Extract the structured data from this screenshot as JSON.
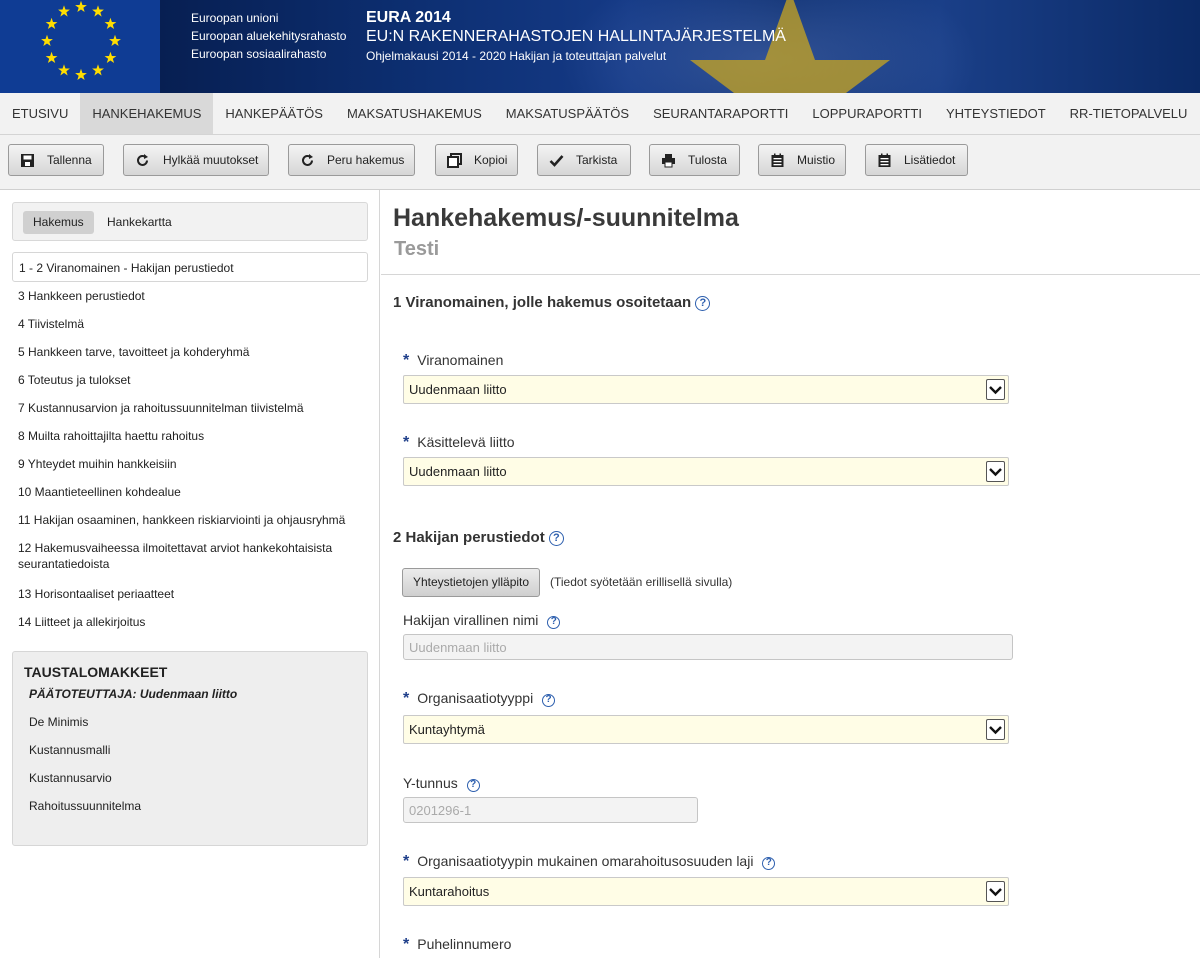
{
  "header": {
    "funds": [
      "Euroopan unioni",
      "Euroopan aluekehitysrahasto",
      "Euroopan sosiaalirahasto"
    ],
    "title": "EURA 2014",
    "subtitle": "EU:N RAKENNERAHASTOJEN HALLINTAJÄRJESTELMÄ",
    "tagline": "Ohjelmakausi 2014 - 2020 Hakijan ja toteuttajan palvelut",
    "flag_color": "#0f3c94",
    "star_color": "#ffdd00"
  },
  "nav": {
    "items": [
      "Etusivu",
      "Hankehakemus",
      "Hankepäätös",
      "Maksatushakemus",
      "Maksatuspäätös",
      "Seurantaraportti",
      "Loppuraportti",
      "Yhteystiedot",
      "RR-tietopalvelu"
    ],
    "active_index": 1
  },
  "toolbar": {
    "save": "Tallenna",
    "reject": "Hylkää muutokset",
    "cancel": "Peru hakemus",
    "copy": "Kopioi",
    "check": "Tarkista",
    "print": "Tulosta",
    "memo": "Muistio",
    "info": "Lisätiedot"
  },
  "sidebar": {
    "tabs": [
      "Hakemus",
      "Hankekartta"
    ],
    "items": [
      "1 - 2 Viranomainen - Hakijan perustiedot",
      "3 Hankkeen perustiedot",
      "4 Tiivistelmä",
      "5 Hankkeen tarve, tavoitteet ja kohderyhmä",
      "6 Toteutus ja tulokset",
      "7 Kustannusarvion ja rahoitussuunnitelman tiivistelmä",
      "8 Muilta rahoittajilta haettu rahoitus",
      "9 Yhteydet muihin hankkeisiin",
      "10 Maantieteellinen kohdealue",
      "11 Hakijan osaaminen, hankkeen riskiarviointi ja ohjausryhmä",
      "12 Hakemusvaiheessa ilmoitettavat arviot hankekohtaisista seurantatiedoista",
      "13 Horisontaaliset periaatteet",
      "14 Liitteet ja allekirjoitus"
    ],
    "background_forms": {
      "heading": "TAUSTALOMAKKEET",
      "main_implementer": "PÄÄTOTEUTTAJA: Uudenmaan liitto",
      "items": [
        "De Minimis",
        "Kustannusmalli",
        "Kustannusarvio",
        "Rahoitussuunnitelma"
      ]
    }
  },
  "main": {
    "title": "Hankehakemus/-suunnitelma",
    "subtitle": "Testi",
    "section1": {
      "heading": "1 Viranomainen, jolle hakemus osoitetaan",
      "authority_label": "Viranomainen",
      "authority_value": "Uudenmaan liitto",
      "handler_label": "Käsittelevä liitto",
      "handler_value": "Uudenmaan liitto"
    },
    "section2": {
      "heading": "2 Hakijan perustiedot",
      "contact_button": "Yhteystietojen ylläpito",
      "contact_note": "(Tiedot syötetään erillisellä sivulla)",
      "official_name_label": "Hakijan virallinen nimi",
      "official_name_value": "Uudenmaan liitto",
      "org_type_label": "Organisaatiotyyppi",
      "org_type_value": "Kuntayhtymä",
      "ytunnus_label": "Y-tunnus",
      "ytunnus_value": "0201296-1",
      "own_funding_label": "Organisaatiotyypin mukainen omarahoitusosuuden laji",
      "own_funding_value": "Kuntarahoitus",
      "phone_label": "Puhelinnumero"
    },
    "required_mark": "*",
    "help_mark": "?"
  }
}
